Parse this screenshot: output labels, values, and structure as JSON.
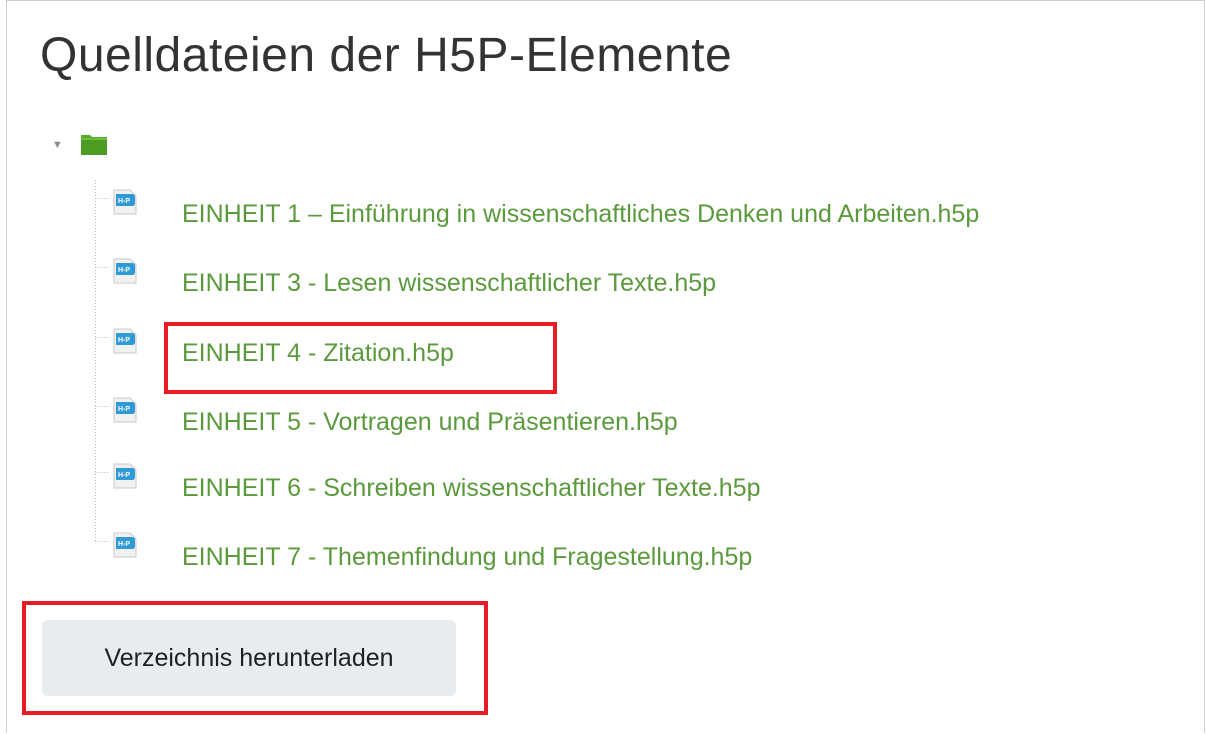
{
  "page": {
    "title": "Quelldateien der H5P-Elemente"
  },
  "tree": {
    "root": {
      "toggle_icon": "triangle-down-icon",
      "folder_icon": "folder-icon",
      "folder_color": "#5aa72b"
    },
    "files": [
      {
        "name": "EINHEIT 1 – Einführung in wissenschaftliches Denken und Arbeiten.h5p",
        "icon": "h5p-file-icon"
      },
      {
        "name": "EINHEIT 3 - Lesen wissenschaftlicher Texte.h5p",
        "icon": "h5p-file-icon"
      },
      {
        "name": "EINHEIT 4 - Zitation.h5p",
        "icon": "h5p-file-icon"
      },
      {
        "name": "EINHEIT 5 - Vortragen und Präsentieren.h5p",
        "icon": "h5p-file-icon"
      },
      {
        "name": "EINHEIT 6 - Schreiben wissenschaftlicher Texte.h5p",
        "icon": "h5p-file-icon"
      },
      {
        "name": "EINHEIT 7 - Themenfindung und Fragestellung.h5p",
        "icon": "h5p-file-icon"
      }
    ],
    "link_color": "#5a9a3c"
  },
  "actions": {
    "download_label": "Verzeichnis herunterladen"
  },
  "annotations": {
    "highlight_color": "#e81c24"
  }
}
